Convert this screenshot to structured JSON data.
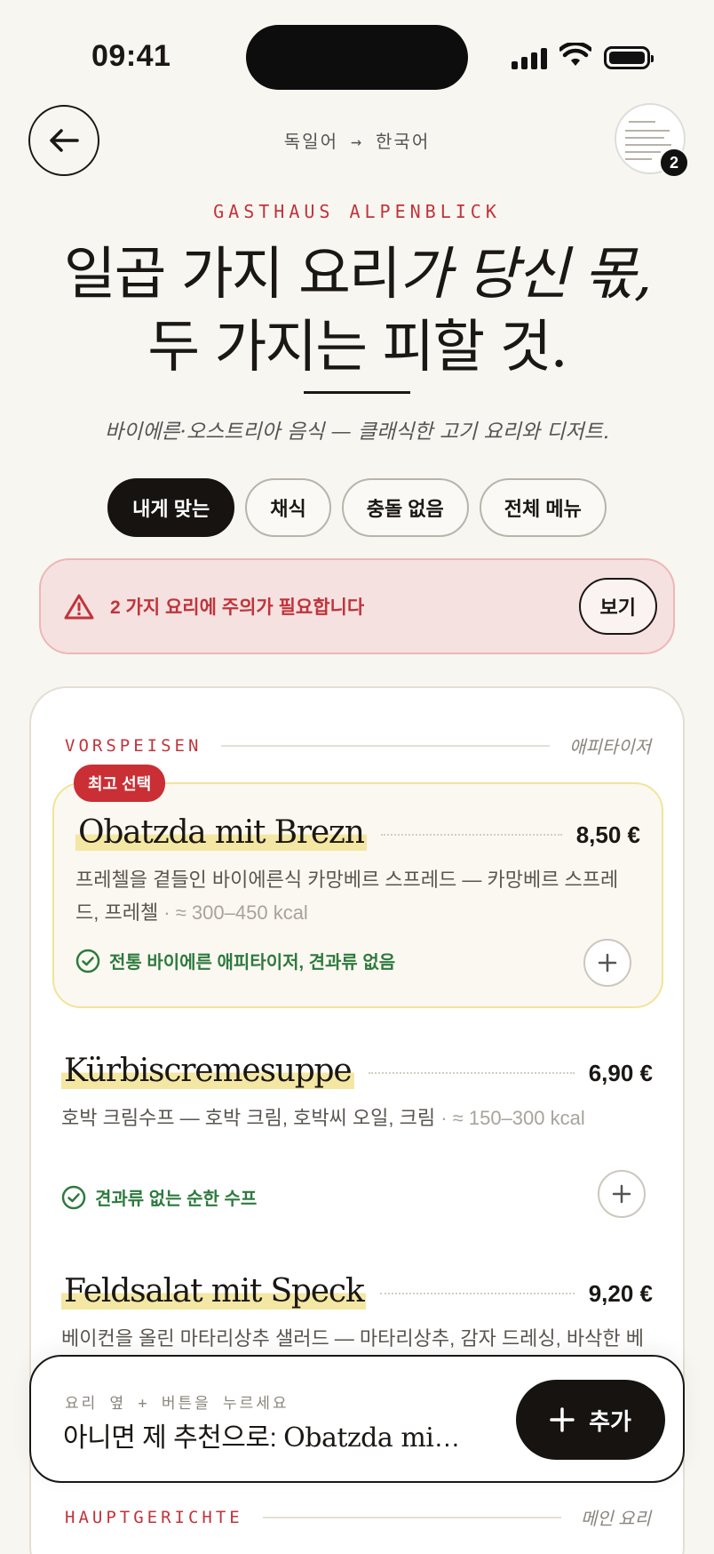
{
  "status_bar": {
    "time": "09:41"
  },
  "header": {
    "lang_from": "독일어",
    "lang_arrow": "→",
    "lang_to": "한국어",
    "scan_count": "2"
  },
  "hero": {
    "restaurant": "GASTHAUS ALPENBLICK",
    "headline_line1_a": "일곱 가지 요리",
    "headline_line1_b": "가 당신 몫,",
    "headline_line2": "두 가지는 피할 것.",
    "subtitle": "바이에른·오스트리아 음식 — 클래식한 고기 요리와 디저트."
  },
  "tabs": [
    {
      "label": "내게 맞는",
      "active": true
    },
    {
      "label": "채식"
    },
    {
      "label": "충돌 없음"
    },
    {
      "label": "전체 메뉴"
    }
  ],
  "alert": {
    "text": "2 가지 요리에 주의가 필요합니다",
    "button": "보기"
  },
  "sections": [
    {
      "de": "VORSPEISEN",
      "ko": "애피타이저"
    },
    {
      "de": "HAUPTGERICHTE",
      "ko": "메인 요리"
    }
  ],
  "badge_top_pick": "최고 선택",
  "dishes": [
    {
      "name": "Obatzda mit Brezn",
      "price": "8,50 €",
      "desc": "프레첼을 곁들인 바이에른식 카망베르 스프레드 — 카망베르 스프레드, 프레첼",
      "sep": " · ",
      "kcal": "≈ 300–450 kcal",
      "note": "전통 바이에른 애피타이저, 견과류 없음"
    },
    {
      "name": "Kürbiscremesuppe",
      "price": "6,90 €",
      "desc": "호박 크림수프 — 호박 크림, 호박씨 오일, 크림",
      "sep": " · ",
      "kcal": "≈ 150–300 kcal",
      "note": "견과류 없는 순한 수프"
    },
    {
      "name": "Feldsalat mit Speck",
      "price": "9,20 €",
      "desc": "베이컨을 올린 마타리상추 샐러드 — 마타리상추, 감자 드레싱, 바삭한 베이컨"
    }
  ],
  "bottom_bar": {
    "hint": "요리 옆 + 버튼을 누르세요",
    "main_prefix": "아니면 제 추천으로: ",
    "main_dish": "Obatzda mit Brezn",
    "add_label": "추가"
  },
  "colors": {
    "accent_red": "#c0343a",
    "ok_green": "#2e7a3e",
    "highlight": "#f4e7a4",
    "ink": "#1a1714",
    "paper": "#f8f6f1"
  }
}
